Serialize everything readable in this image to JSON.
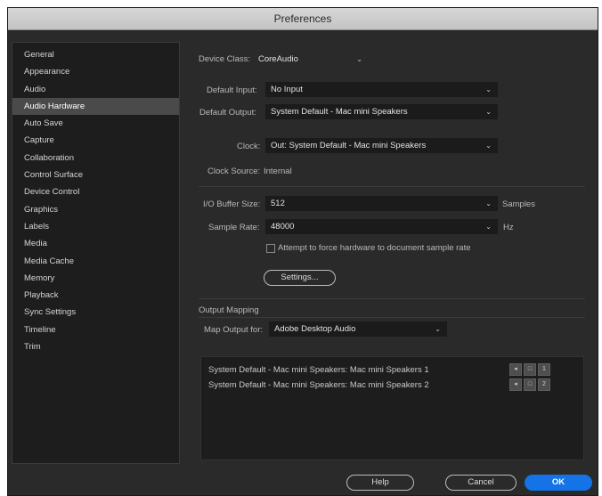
{
  "window": {
    "title": "Preferences"
  },
  "sidebar": {
    "items": [
      {
        "label": "General"
      },
      {
        "label": "Appearance"
      },
      {
        "label": "Audio"
      },
      {
        "label": "Audio Hardware",
        "selected": true
      },
      {
        "label": "Auto Save"
      },
      {
        "label": "Capture"
      },
      {
        "label": "Collaboration"
      },
      {
        "label": "Control Surface"
      },
      {
        "label": "Device Control"
      },
      {
        "label": "Graphics"
      },
      {
        "label": "Labels"
      },
      {
        "label": "Media"
      },
      {
        "label": "Media Cache"
      },
      {
        "label": "Memory"
      },
      {
        "label": "Playback"
      },
      {
        "label": "Sync Settings"
      },
      {
        "label": "Timeline"
      },
      {
        "label": "Trim"
      }
    ]
  },
  "audio_hardware": {
    "device_class": {
      "label": "Device Class:",
      "value": "CoreAudio"
    },
    "default_input": {
      "label": "Default Input:",
      "value": "No Input"
    },
    "default_output": {
      "label": "Default Output:",
      "value": "System Default - Mac mini Speakers"
    },
    "clock": {
      "label": "Clock:",
      "value": "Out: System Default - Mac mini Speakers"
    },
    "clock_source": {
      "label": "Clock Source:",
      "value": "Internal"
    },
    "io_buffer_size": {
      "label": "I/O Buffer Size:",
      "value": "512",
      "unit": "Samples"
    },
    "sample_rate": {
      "label": "Sample Rate:",
      "value": "48000",
      "unit": "Hz"
    },
    "force_rate_checkbox": {
      "label": "Attempt to force hardware to document sample rate",
      "checked": false
    },
    "settings_button": {
      "label": "Settings..."
    }
  },
  "output_mapping": {
    "heading": "Output Mapping",
    "map_output_for": {
      "label": "Map Output for:",
      "value": "Adobe Desktop Audio"
    },
    "rows": [
      {
        "label": "System Default - Mac mini Speakers: Mac mini Speakers 1",
        "icon": "speaker-left-icon",
        "channel": "1"
      },
      {
        "label": "System Default - Mac mini Speakers: Mac mini Speakers 2",
        "icon": "speaker-right-icon",
        "channel": "2"
      }
    ]
  },
  "footer": {
    "help_label": "Help",
    "cancel_label": "Cancel",
    "ok_label": "OK"
  },
  "colors": {
    "accent": "#1473e6",
    "background": "#2a2a2a",
    "panel": "#1d1d1d"
  }
}
